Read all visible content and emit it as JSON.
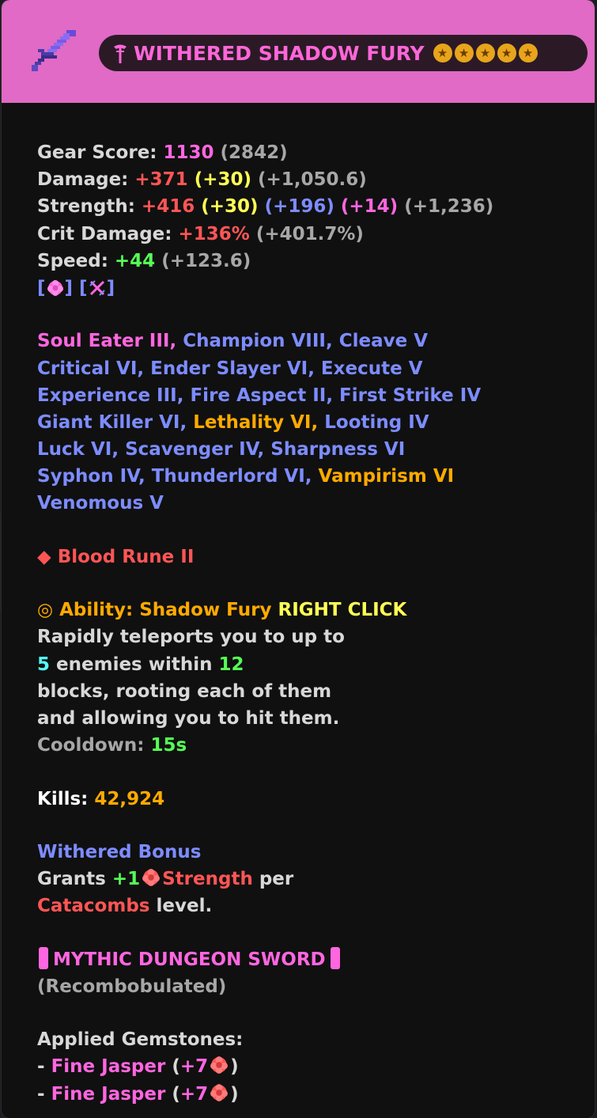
{
  "colors": {
    "header_bg": "#e06ac5",
    "card_bg": "#101010",
    "pink": "#ff66e0",
    "red": "#ff5555",
    "yellow": "#ffff55",
    "blue": "#7d8cff",
    "green": "#55ff55",
    "gold": "#ffaa00",
    "aqua": "#55ffff",
    "gray": "#a7a7a7"
  },
  "header": {
    "icon": "sword-icon",
    "name": "WITHERED SHADOW FURY",
    "name_icon": "dungeon-staff-icon",
    "stars": 5,
    "star_icon": "dungeon-star-icon"
  },
  "stats": {
    "gear_score": {
      "label": "Gear Score:",
      "value": "1130",
      "extra": "(2842)"
    },
    "damage": {
      "label": "Damage:",
      "value": "+371",
      "reforge": "(+30)",
      "dungeon": "(+1,050.6)"
    },
    "strength": {
      "label": "Strength:",
      "value": "+416",
      "reforge": "(+30)",
      "hpb": "(+196)",
      "gem": "(+14)",
      "dungeon": "(+1,236)"
    },
    "crit_damage": {
      "label": "Crit Damage:",
      "value": "+136%",
      "dungeon": "(+401.7%)"
    },
    "speed": {
      "label": "Speed:",
      "value": "+44",
      "dungeon": "(+123.6)"
    }
  },
  "gem_slots": [
    "jasper-gem-icon",
    "combat-slot-icon"
  ],
  "enchants": {
    "line1": {
      "ultimate": "Soul Eater III,",
      "rest": "Champion VIII, Cleave V"
    },
    "line2": "Critical VI, Ender Slayer VI, Execute V",
    "line3": "Experience III, Fire Aspect II, First Strike IV",
    "line4": {
      "a": "Giant Killer VI,",
      "b": "Lethality VI,",
      "c": "Looting IV"
    },
    "line5": "Luck VI, Scavenger IV, Sharpness VI",
    "line6": {
      "a": "Syphon IV, Thunderlord VI,",
      "b": "Vampirism VI"
    },
    "line7": "Venomous V"
  },
  "rune": {
    "symbol": "◆",
    "name": "Blood Rune II"
  },
  "ability": {
    "symbol": "◎",
    "title": "Ability: Shadow Fury",
    "trigger": "RIGHT CLICK",
    "line1": "Rapidly teleports you to up to",
    "count": "5",
    "mid": "enemies within",
    "blocks": "12",
    "line3": "blocks, rooting each of them",
    "line4": "and allowing you to hit them.",
    "cooldown_label": "Cooldown:",
    "cooldown_value": "15s"
  },
  "kills": {
    "label": "Kills:",
    "value": "42,924"
  },
  "bonus": {
    "title": "Withered Bonus",
    "grants": "Grants",
    "amount": "+1",
    "stat": "Strength",
    "per": "per",
    "source": "Catacombs",
    "level": "level."
  },
  "rarity": {
    "text": "MYTHIC DUNGEON SWORD",
    "recomb": "(Recombobulated)"
  },
  "gemstones": {
    "title": "Applied Gemstones:",
    "items": [
      {
        "dash": "-",
        "name": "Fine Jasper",
        "open": "(",
        "value": "+7",
        "close": ")"
      },
      {
        "dash": "-",
        "name": "Fine Jasper",
        "open": "(",
        "value": "+7",
        "close": ")"
      }
    ]
  }
}
